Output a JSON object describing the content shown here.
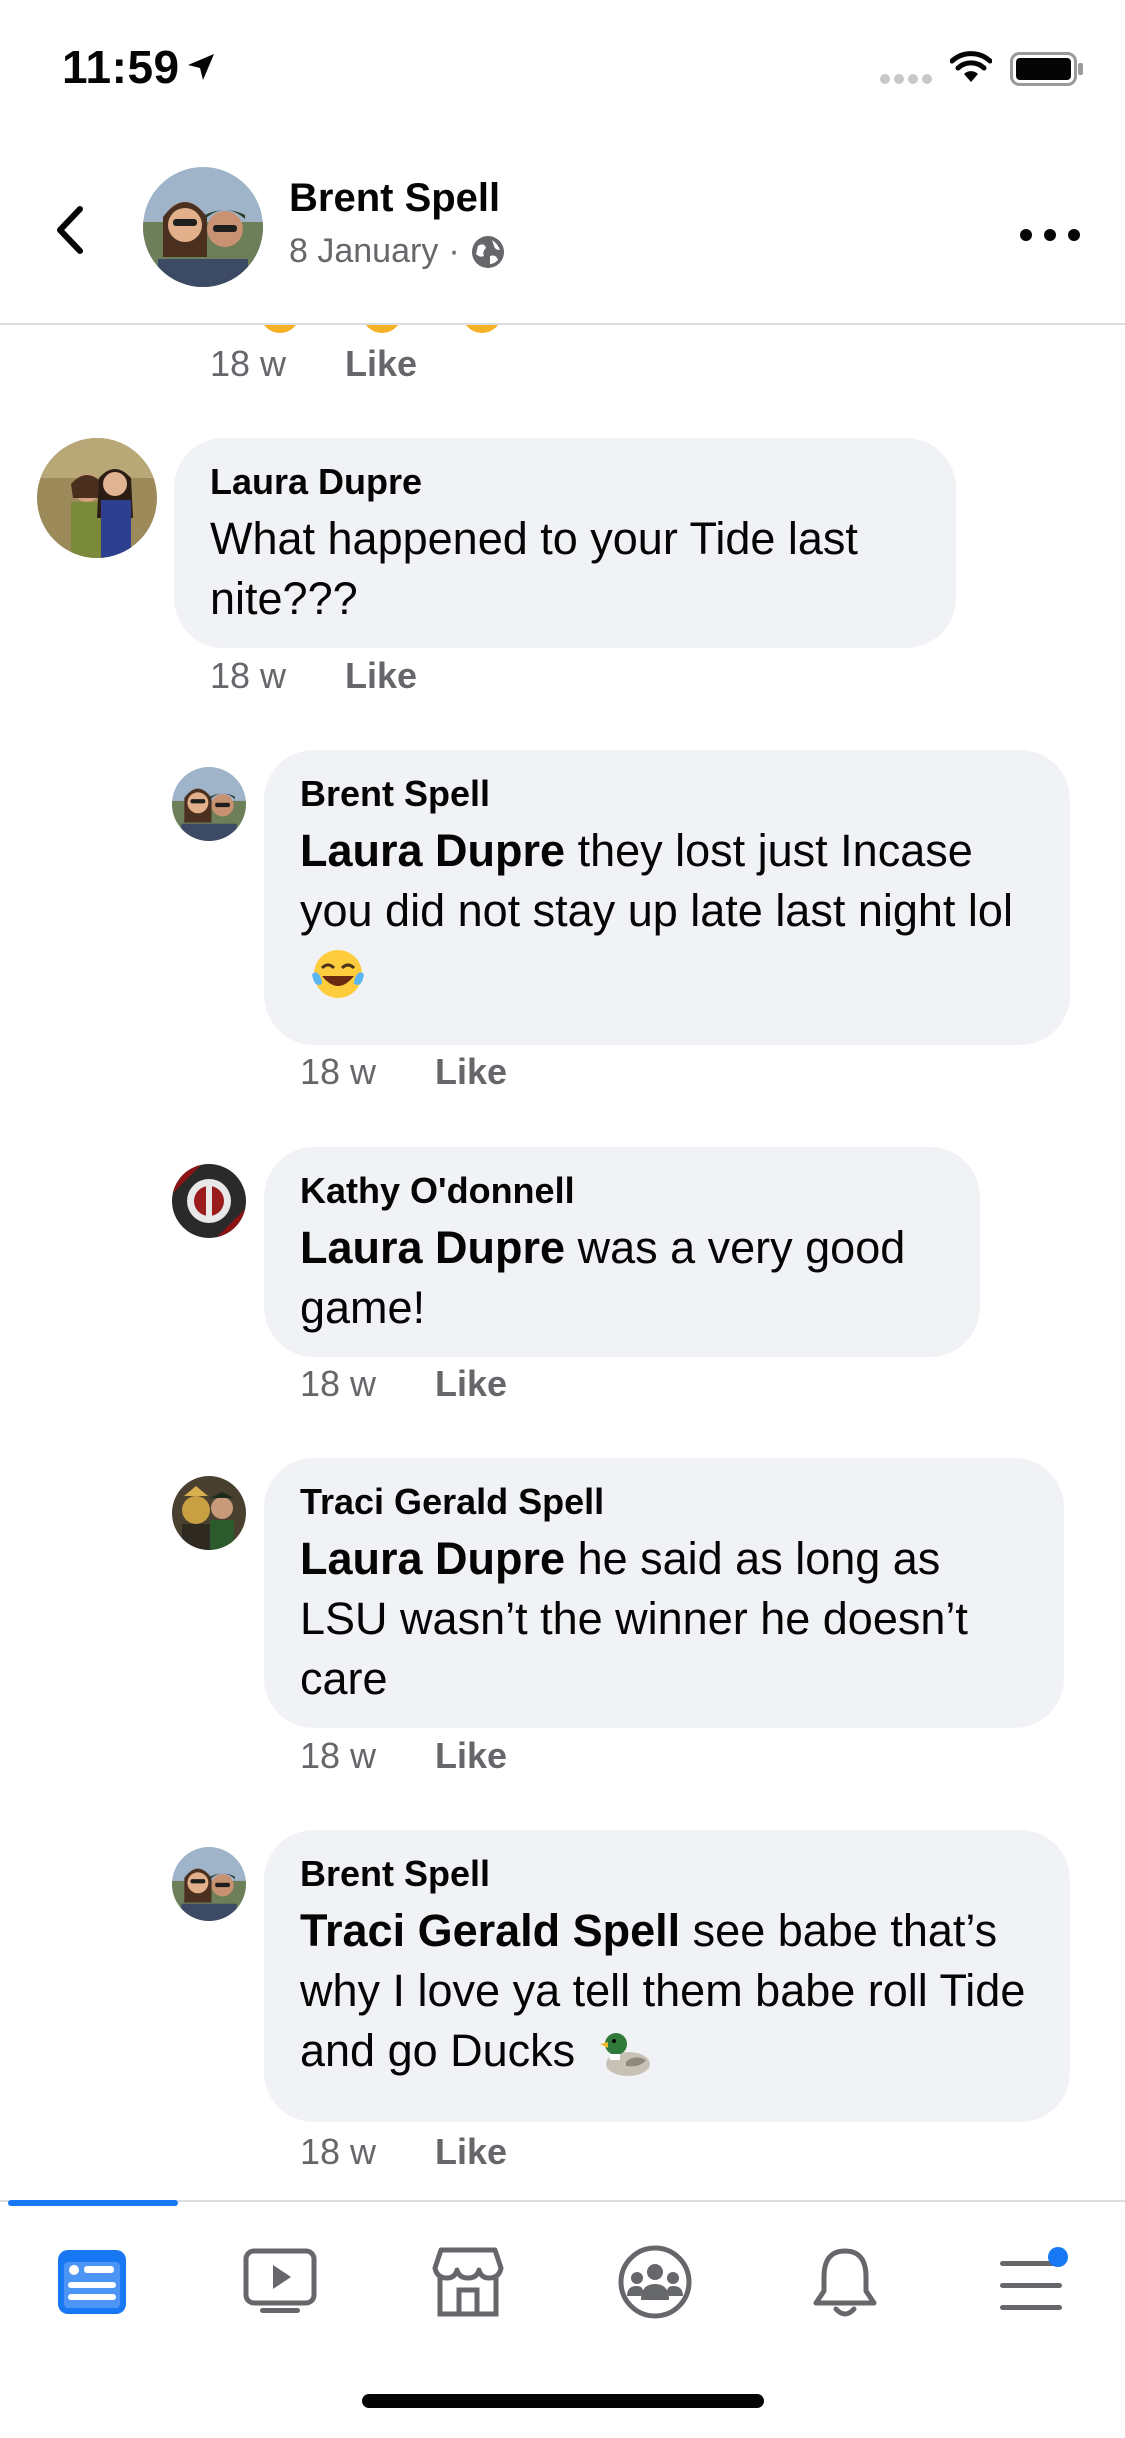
{
  "status_bar": {
    "time": "11:59"
  },
  "header": {
    "name": "Brent Spell",
    "date": "8 January",
    "separator": "·"
  },
  "comments": [
    {
      "time": "18 w",
      "like": "Like"
    },
    {
      "author": "Laura Dupre",
      "text": "What happened to your Tide last nite???",
      "time": "18 w",
      "like": "Like"
    },
    {
      "author": "Brent Spell",
      "mention": "Laura Dupre",
      "text": " they lost just Incase you did not stay up late last night lol",
      "emoji": "face-with-tears-of-joy",
      "time": "18 w",
      "like": "Like"
    },
    {
      "author": "Kathy O'donnell",
      "mention": "Laura Dupre",
      "text": " was a very good game!",
      "time": "18 w",
      "like": "Like"
    },
    {
      "author": "Traci Gerald Spell",
      "mention": "Laura Dupre",
      "text": " he said as long as LSU wasn’t the winner he doesn’t care",
      "time": "18 w",
      "like": "Like"
    },
    {
      "author": "Brent Spell",
      "mention": "Traci Gerald Spell",
      "text": " see babe that’s why I love ya tell them babe roll Tide and go Ducks",
      "emoji": "duck",
      "time": "18 w",
      "like": "Like"
    }
  ],
  "tabbar": {
    "tabs": [
      "news-feed",
      "watch",
      "marketplace",
      "groups",
      "notifications",
      "menu"
    ],
    "active": "news-feed",
    "accent": "#1877f2"
  },
  "colors": {
    "bubble": "#f0f2f5",
    "secondary_text": "#65676b",
    "divider": "#dadde1"
  }
}
